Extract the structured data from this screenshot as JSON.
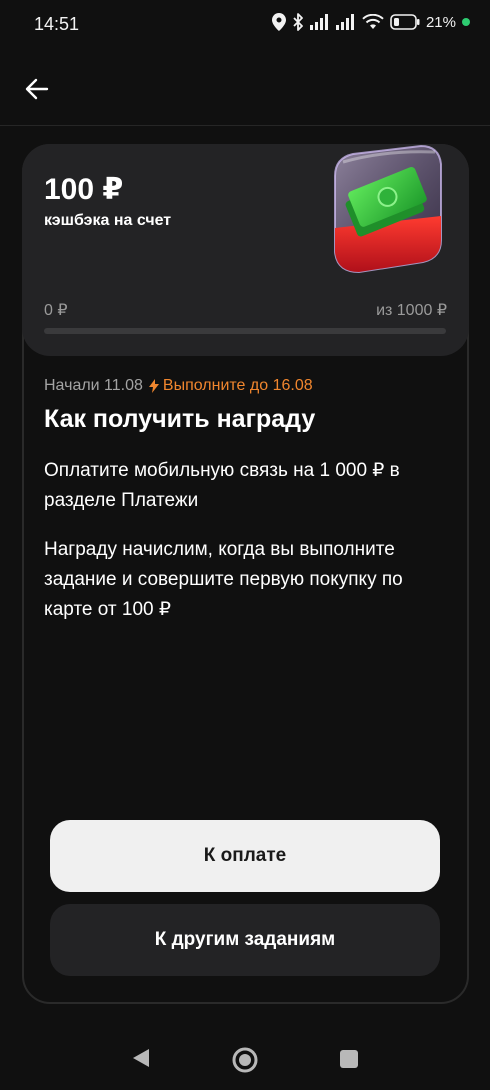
{
  "status_bar": {
    "time": "14:51",
    "battery_percent": "21%",
    "icons": [
      "location-icon",
      "bluetooth-icon",
      "signal-icon",
      "signal-icon",
      "wifi-icon",
      "battery-icon",
      "charging-dot"
    ]
  },
  "nav": {
    "back_icon": "arrow-left-icon"
  },
  "reward": {
    "amount": "100 ₽",
    "subtitle": "кэшбэка на счет",
    "progress_start": "0 ₽",
    "progress_end": "из 1000 ₽",
    "progress_fraction": 0
  },
  "task": {
    "started": "Начали 11.08",
    "deadline": "Выполните до 16.08",
    "title": "Как получить награду",
    "paragraph_1": "Оплатите мобильную связь на 1 000 ₽ в разделе Платежи",
    "paragraph_2": "Награду начислим, когда вы выполните задание и совершите первую покупку по карте от 100 ₽"
  },
  "buttons": {
    "pay": "К оплате",
    "other_tasks": "К другим заданиям"
  },
  "colors": {
    "background": "#101010",
    "card": "#232325",
    "accent_orange": "#f0862e",
    "primary_button": "#f0f0f0"
  }
}
